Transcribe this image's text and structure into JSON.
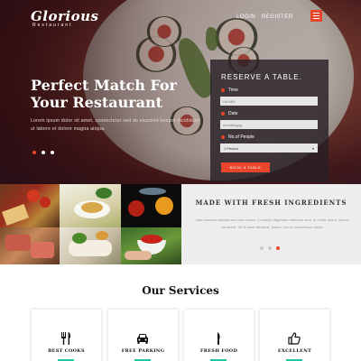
{
  "brand": {
    "name": "Glorious",
    "tagline": "Restaurant"
  },
  "nav": {
    "login": "LOGIN",
    "register": "REGISTER"
  },
  "hero": {
    "title": "Perfect Match For Your Restaurant",
    "text": "Lorem ipsum dolor sit amet, consectetur sed do eiusmod tempor incididunt ut labore et dolore magna aliqua.",
    "active_slide": 1,
    "slide_count": 3
  },
  "reservation": {
    "title": "RESERVE A TABLE.",
    "time_label": "Time",
    "time_placeholder": "HH:MM",
    "date_label": "Date",
    "date_placeholder": "mm/dd/yyyy",
    "people_label": "No.of People",
    "people_value": "1 Person",
    "book_label": "BOOK A TABLE"
  },
  "fresh": {
    "title": "MADE WITH FRESH INGREDIENTS",
    "text": "Nam tempus lobortis sem non ornare. Curabitur dignissim interdum sem, et mollis lorem, dictum hendrerit. Sit et amet faucibus, ipsum, nisi eu scelerisque turpis.",
    "active_slide": 3,
    "slide_count": 3
  },
  "services": {
    "title": "Our Services",
    "items": [
      {
        "label": "BEST COOKS",
        "icon": "cutlery-icon"
      },
      {
        "label": "FREE PARKING",
        "icon": "car-icon"
      },
      {
        "label": "FRESH FOOD",
        "icon": "knife-icon"
      },
      {
        "label": "EXCELLENT",
        "icon": "thumbs-up-icon"
      }
    ]
  },
  "colors": {
    "accent": "#e8452b",
    "teal": "#1dc9a0"
  }
}
